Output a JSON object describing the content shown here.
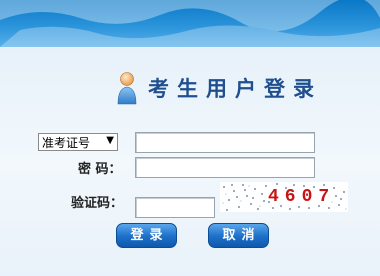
{
  "title": "考生用户登录",
  "form": {
    "id_type_selected": "准考证号",
    "id_value": "",
    "password_label": "密  码：",
    "password_value": "",
    "captcha_label": "验证码：",
    "captcha_value": "",
    "captcha_text": "4607"
  },
  "buttons": {
    "login": "登录",
    "cancel": "取消"
  },
  "icons": {
    "user": "user-icon",
    "dropdown": "chevron-down-icon"
  },
  "colors": {
    "banner": "#1a86d2",
    "title": "#1f4f8f",
    "button": "#1c6fc8",
    "captcha_text": "#c81414"
  }
}
